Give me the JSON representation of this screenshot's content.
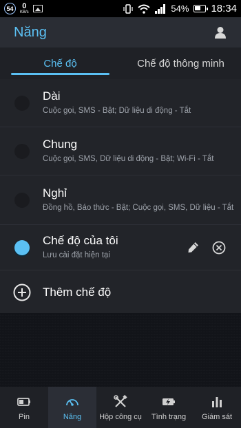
{
  "status_bar": {
    "notif_count": "54",
    "net_speed": "0",
    "net_unit": "KB/s",
    "battery_pct": "54%",
    "time": "18:34"
  },
  "app_bar": {
    "title": "Năng"
  },
  "tabs": [
    {
      "label": "Chế độ",
      "active": true
    },
    {
      "label": "Chế độ thông minh",
      "active": false
    }
  ],
  "modes": [
    {
      "name": "Dài",
      "desc": "Cuộc gọi, SMS - Bật; Dữ liệu di động - Tắt",
      "active": false
    },
    {
      "name": "Chung",
      "desc": "Cuộc gọi, SMS, Dữ liệu di động - Bật; Wi-Fi - Tắt",
      "active": false
    },
    {
      "name": "Nghỉ",
      "desc": "Đồng hồ, Báo thức - Bật; Cuộc gọi, SMS, Dữ liệu - Tắt",
      "active": false
    },
    {
      "name": "Chế độ của tôi",
      "desc": "Lưu cài đặt hiện tại",
      "active": true
    }
  ],
  "add_mode_label": "Thêm chế độ",
  "bottom_nav": [
    {
      "label": "Pin",
      "icon": "battery-icon"
    },
    {
      "label": "Năng",
      "icon": "gauge-icon",
      "active": true
    },
    {
      "label": "Hộp công cụ",
      "icon": "tools-icon"
    },
    {
      "label": "Tình trạng",
      "icon": "battery-charging-icon"
    },
    {
      "label": "Giám sát",
      "icon": "bar-chart-icon"
    }
  ],
  "colors": {
    "accent": "#5bc0f3",
    "app_bar_bg": "#2a2d34",
    "list_bg": "#222429"
  }
}
